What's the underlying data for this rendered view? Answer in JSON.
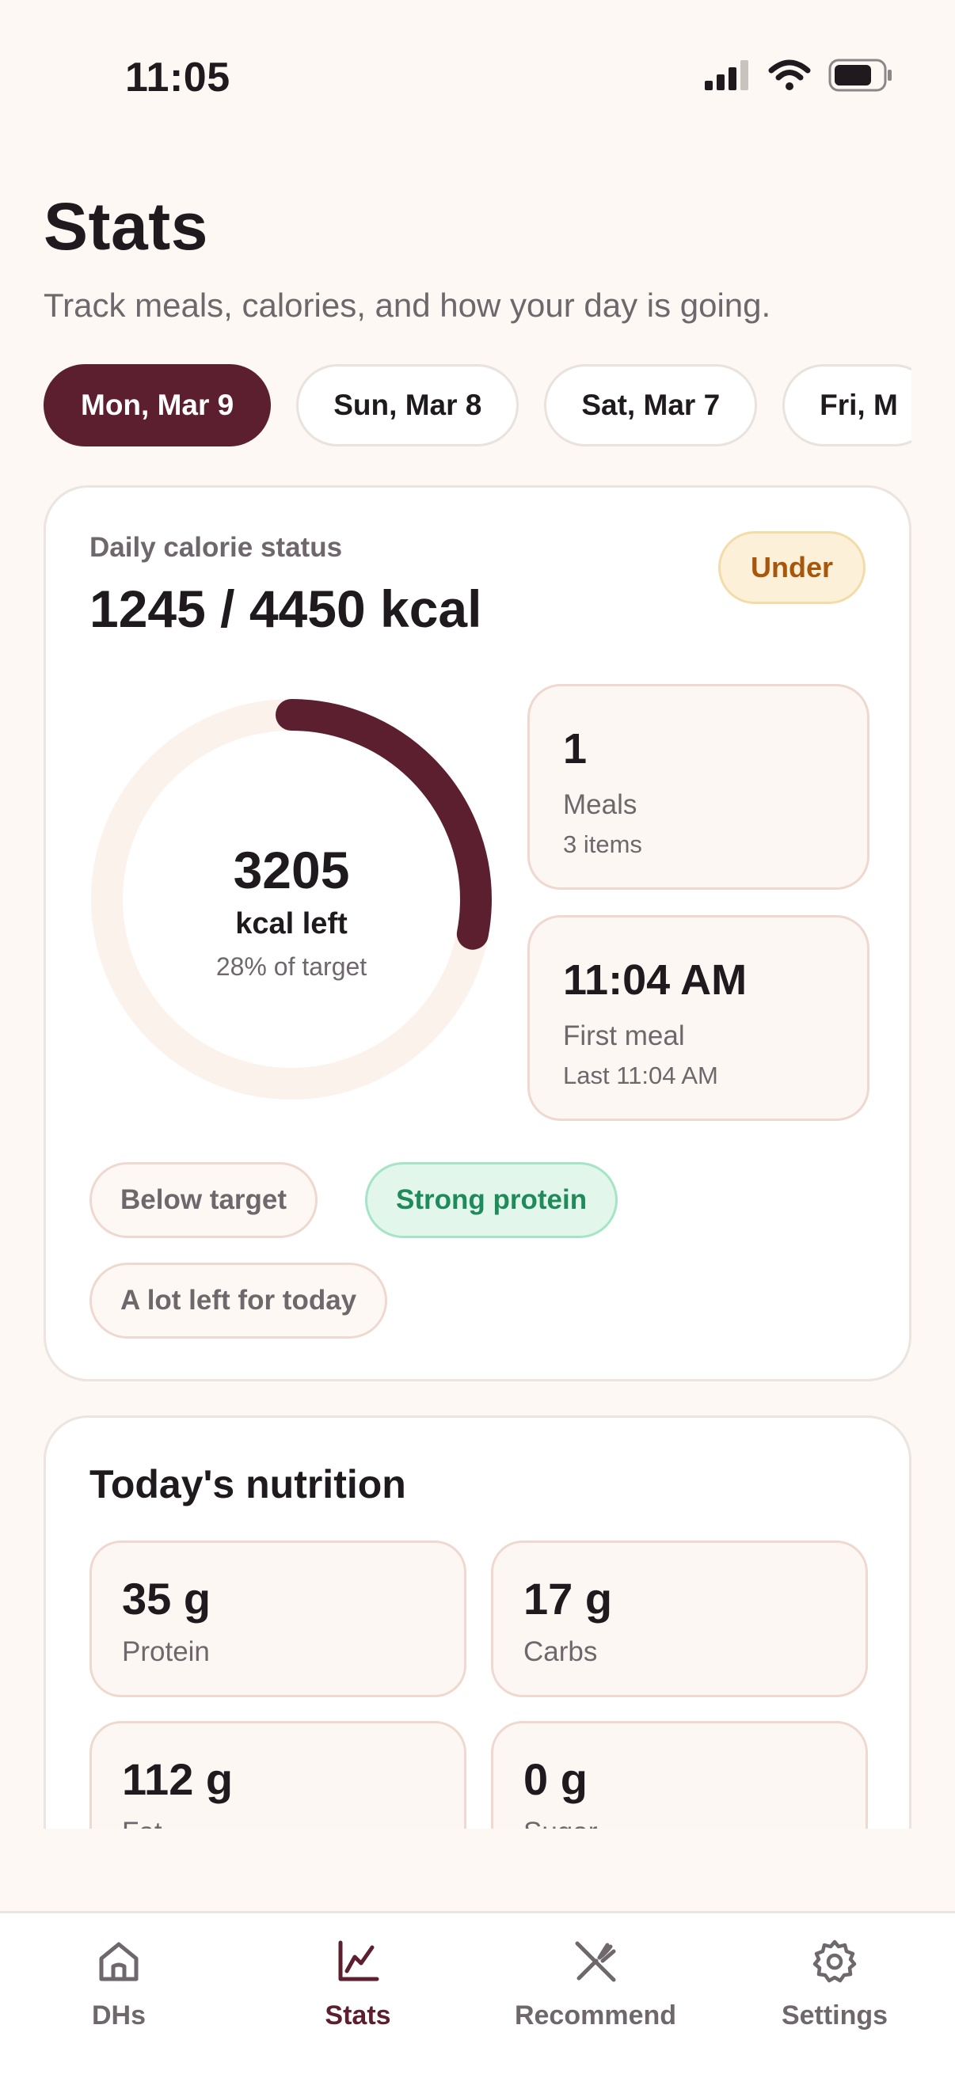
{
  "status_bar": {
    "time": "11:05"
  },
  "header": {
    "title": "Stats",
    "subtitle": "Track meals, calories, and how your day is going."
  },
  "dates": [
    "Mon, Mar 9",
    "Sun, Mar 8",
    "Sat, Mar 7",
    "Fri, M"
  ],
  "calorie_card": {
    "label": "Daily calorie status",
    "value": "1245 / 4450 kcal",
    "badge": "Under",
    "ring": {
      "value": "3205",
      "label": "kcal left",
      "sub": "28% of target",
      "progress": 0.28
    },
    "meals": {
      "value": "1",
      "label": "Meals",
      "sub": "3 items"
    },
    "first_meal": {
      "value": "11:04 AM",
      "label": "First meal",
      "sub": "Last 11:04 AM"
    },
    "tags": [
      "Below target",
      "Strong protein",
      "A lot left for today"
    ]
  },
  "nutrition": {
    "title": "Today's nutrition",
    "items": [
      {
        "value": "35 g",
        "label": "Protein"
      },
      {
        "value": "17 g",
        "label": "Carbs"
      },
      {
        "value": "112 g",
        "label": "Fat"
      },
      {
        "value": "0 g",
        "label": "Sugar"
      }
    ]
  },
  "tab_bar": {
    "items": [
      {
        "label": "DHs",
        "icon": "home-icon"
      },
      {
        "label": "Stats",
        "icon": "chart-icon"
      },
      {
        "label": "Recommend",
        "icon": "utensils-icon"
      },
      {
        "label": "Settings",
        "icon": "gear-icon"
      }
    ],
    "active": "Stats"
  },
  "colors": {
    "accent": "#5c1f2f",
    "background": "#fdf8f4",
    "under_badge": "#a8560b",
    "protein_tag": "#1f8a5a"
  }
}
